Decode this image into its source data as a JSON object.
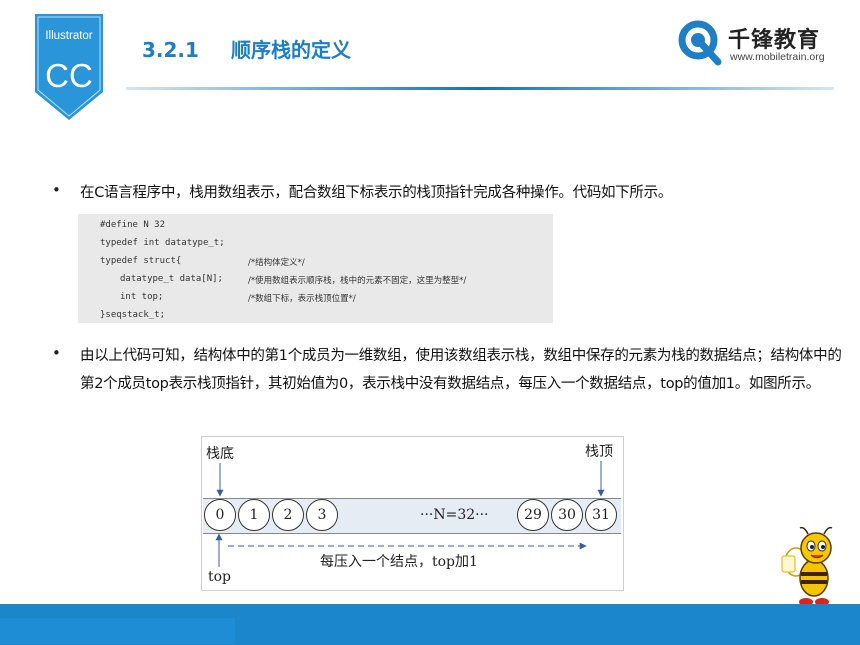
{
  "badge": {
    "label": "Illustrator",
    "abbr": "CC",
    "color": "#2a95d8"
  },
  "header": {
    "section_number": "3.2.1",
    "section_title": "顺序栈的定义",
    "title_color": "#1d7fc3"
  },
  "logo": {
    "name": "千锋教育",
    "url": "www.mobiletrain.org"
  },
  "bullets": [
    {
      "text": "在C语言程序中，栈用数组表示，配合数组下标表示的栈顶指针完成各种操作。代码如下所示。"
    },
    {
      "text": "由以上代码可知，结构体中的第1个成员为一维数组，使用该数组表示栈，数组中保存的元素为栈的数据结点；结构体中的第2个成员top表示栈顶指针，其初始值为0，表示栈中没有数据结点，每压入一个数据结点，top的值加1。如图所示。"
    }
  ],
  "code": {
    "lines": [
      {
        "code": "#define N 32",
        "comment": ""
      },
      {
        "code": "typedef int datatype_t;",
        "comment": ""
      },
      {
        "code": "typedef struct{",
        "comment": "/*结构体定义*/"
      },
      {
        "code": "datatype_t data[N];",
        "comment": "/*使用数组表示顺序栈，栈中的元素不固定，这里为整型*/"
      },
      {
        "code": "int top;",
        "comment": "/*数组下标，表示栈顶位置*/"
      },
      {
        "code": "}seqstack_t;",
        "comment": ""
      }
    ]
  },
  "diagram": {
    "bottom_label": "栈底",
    "top_label": "栈顶",
    "left_cells": [
      "0",
      "1",
      "2",
      "3"
    ],
    "middle": "···N=32···",
    "right_cells": [
      "29",
      "30",
      "31"
    ],
    "arrow_caption": "每压入一个结点，top加1",
    "pointer_label": "top"
  },
  "footer": {
    "color": "#1c86cc"
  }
}
